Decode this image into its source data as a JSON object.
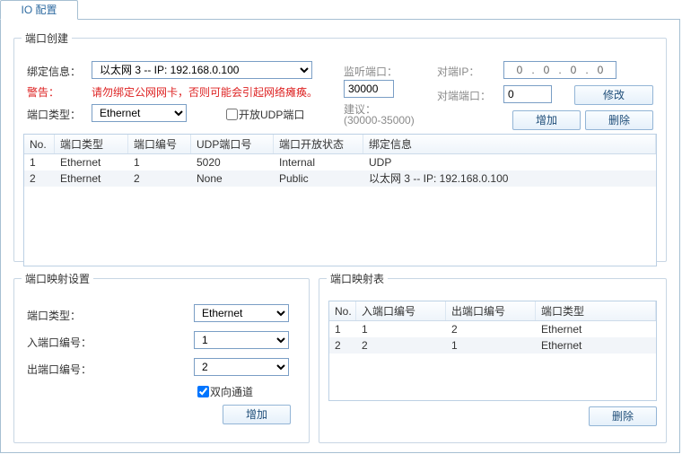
{
  "tab": {
    "label": "IO 配置"
  },
  "create": {
    "legend": "端口创建",
    "bind_label": "绑定信息：",
    "bind_value": "以太网 3 -- IP: 192.168.0.100",
    "warn_label": "警告：",
    "warn_text": "请勿绑定公网网卡，否则可能会引起网络瘫痪。",
    "porttype_label": "端口类型：",
    "porttype_value": "Ethernet",
    "udp_check_label": "开放UDP端口",
    "udp_checked": false,
    "listen_label": "监听端口：",
    "listen_value": "30000",
    "advice_label": "建议：",
    "advice_range": "(30000-35000)",
    "peer_ip_label": "对端IP：",
    "peer_ip": [
      "0",
      "0",
      "0",
      "0"
    ],
    "peer_port_label": "对端端口：",
    "peer_port_value": "0",
    "btn_modify": "修改",
    "btn_add": "增加",
    "btn_del": "删除",
    "table": {
      "headers": [
        "No.",
        "端口类型",
        "端口编号",
        "UDP端口号",
        "端口开放状态",
        "绑定信息"
      ],
      "rows": [
        [
          "1",
          "Ethernet",
          "1",
          "5020",
          "Internal",
          "UDP"
        ],
        [
          "2",
          "Ethernet",
          "2",
          "None",
          "Public",
          "以太网 3 -- IP: 192.168.0.100"
        ]
      ]
    }
  },
  "mapcfg": {
    "legend": "端口映射设置",
    "porttype_label": "端口类型：",
    "porttype_value": "Ethernet",
    "in_label": "入端口编号：",
    "in_value": "1",
    "out_label": "出端口编号：",
    "out_value": "2",
    "dup_label": "双向通道",
    "dup_checked": true,
    "btn_add": "增加"
  },
  "maptbl": {
    "legend": "端口映射表",
    "headers": [
      "No.",
      "入端口编号",
      "出端口编号",
      "端口类型"
    ],
    "rows": [
      [
        "1",
        "1",
        "2",
        "Ethernet"
      ],
      [
        "2",
        "2",
        "1",
        "Ethernet"
      ]
    ],
    "btn_del": "删除"
  }
}
